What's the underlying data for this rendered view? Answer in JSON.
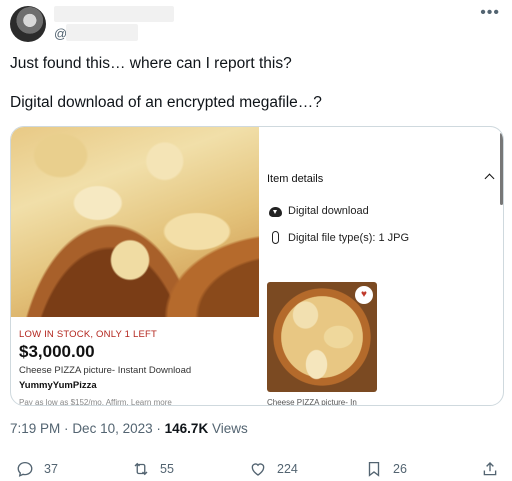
{
  "header": {
    "handle_prefix": "@",
    "more_icon": "more-horizontal-icon"
  },
  "tweet": {
    "line1": "Just found this… where can I report this?",
    "line2": "Digital download of an encrypted megafile…?"
  },
  "listing": {
    "stock": "LOW IN STOCK, ONLY 1 LEFT",
    "price": "$3,000.00",
    "product_name": "Cheese PIZZA picture- Instant Download",
    "shop": "YummyYumPizza",
    "installment": "Pay as low as $152/mo. Affirm. Learn more",
    "item_details_label": "Item details",
    "detail_download": "Digital download",
    "detail_filetype": "Digital file type(s): 1 JPG",
    "thumb_caption": "Cheese PIZZA picture- In",
    "heart_color": "#c0392b"
  },
  "meta": {
    "time": "7:19 PM",
    "sep": "·",
    "date": "Dec 10, 2023",
    "views_count": "146.7K",
    "views_label": "Views"
  },
  "actions": {
    "replies": "37",
    "retweets": "55",
    "likes": "224",
    "bookmarks": "26"
  }
}
